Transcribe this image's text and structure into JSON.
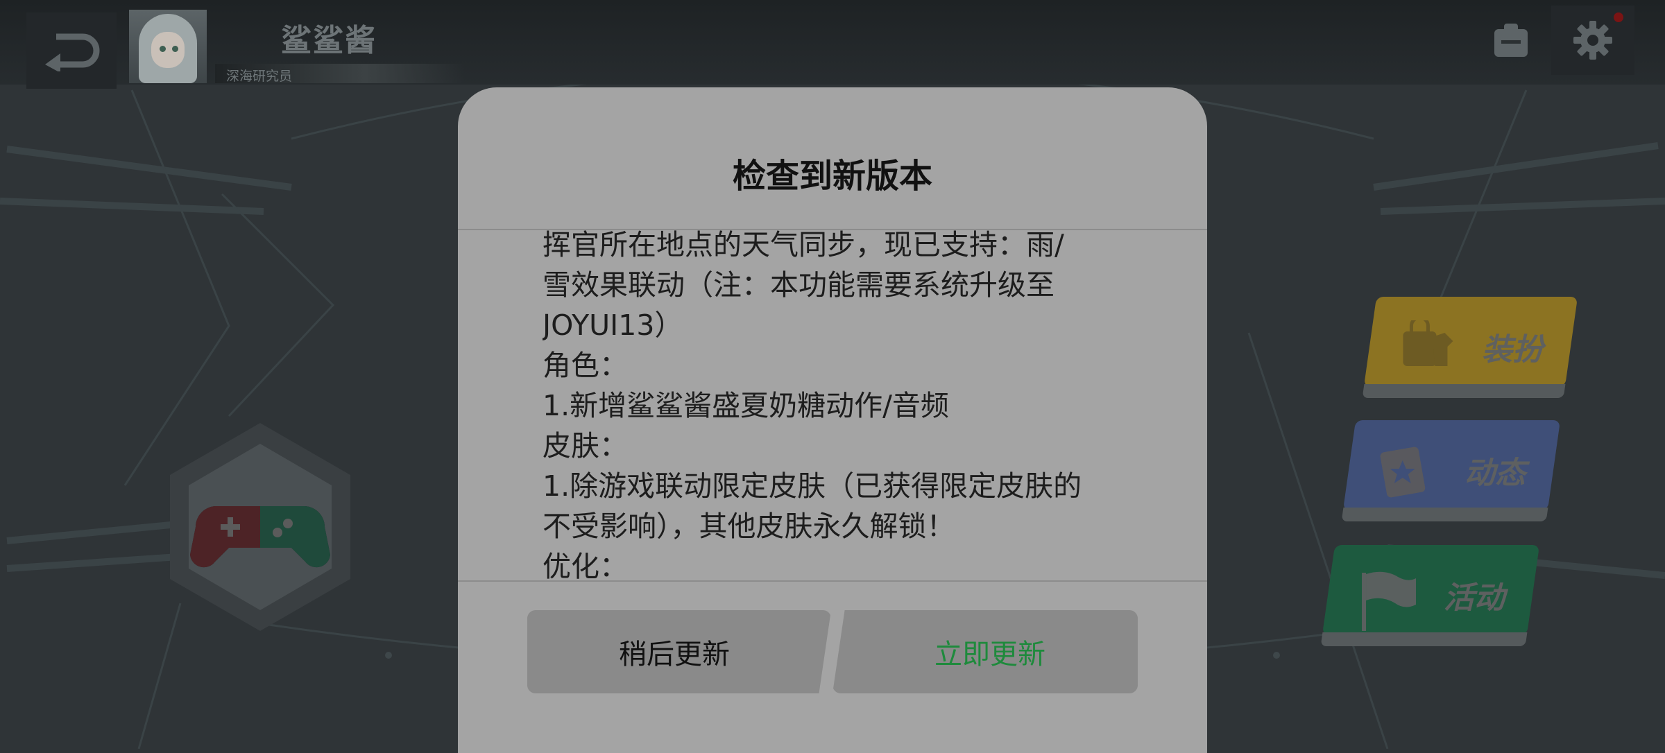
{
  "header": {
    "username": "鲨鲨酱",
    "user_title": "深海研究员"
  },
  "menu": {
    "dress_label": "装扮",
    "dynamic_label": "动态",
    "activity_label": "活动"
  },
  "dialog": {
    "title": "检查到新版本",
    "lines": [
      "挥官所在地点的天气同步，现已支持：雨/",
      "雪效果联动（注：本功能需要系统升级至",
      "JOYUI13）",
      "角色：",
      "1.新增鲨鲨酱盛夏奶糖动作/音频",
      "皮肤：",
      "1.除游戏联动限定皮肤（已获得限定皮肤的",
      "不受影响），其他皮肤永久解锁！",
      "优化："
    ],
    "later_label": "稍后更新",
    "update_label": "立即更新"
  },
  "colors": {
    "update_accent": "#1e8a3c",
    "dialog_bg": "#a4a4a4"
  }
}
